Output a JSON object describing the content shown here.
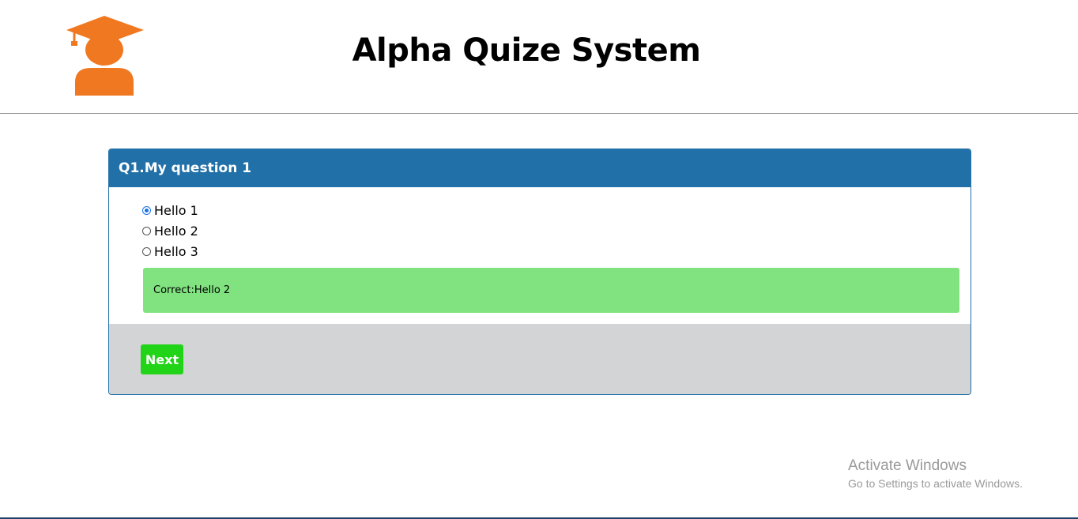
{
  "header": {
    "title": "Alpha Quize System",
    "logo_icon": "graduate-student-icon",
    "logo_color": "#f07820"
  },
  "question": {
    "title": "Q1.My question 1",
    "options": [
      {
        "label": "Hello 1",
        "selected": true
      },
      {
        "label": "Hello 2",
        "selected": false
      },
      {
        "label": "Hello 3",
        "selected": false
      }
    ],
    "result_text": "Correct:Hello 2",
    "next_label": "Next"
  },
  "colors": {
    "card_header": "#2170a8",
    "result_bg": "#80e37f",
    "footer_bg": "#d3d4d6",
    "next_button": "#22d418"
  },
  "watermark": {
    "title": "Activate Windows",
    "subtitle": "Go to Settings to activate Windows."
  }
}
